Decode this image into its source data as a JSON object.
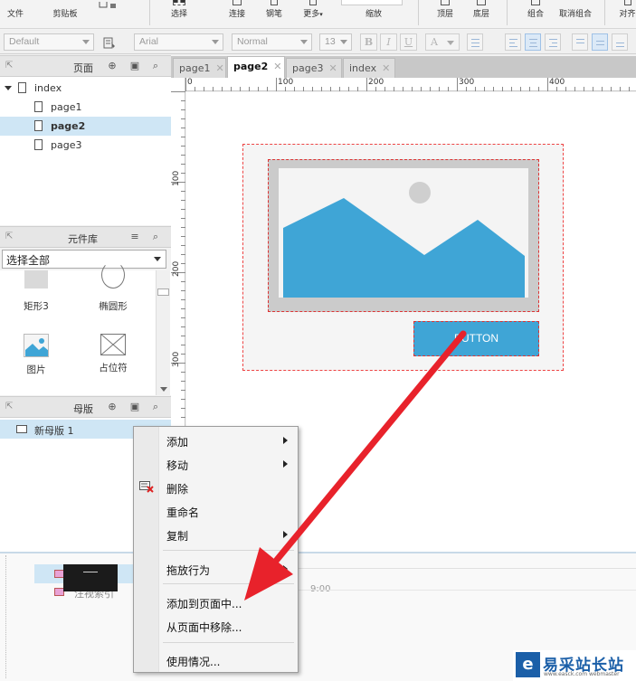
{
  "toolbar": {
    "items": [
      {
        "label": "文件"
      },
      {
        "label": "剪贴板"
      },
      {
        "label": "选择"
      },
      {
        "label": "连接"
      },
      {
        "label": "钢笔"
      },
      {
        "label": "更多"
      },
      {
        "label": "缩放"
      },
      {
        "label": "顶层"
      },
      {
        "label": "底层"
      },
      {
        "label": "组合"
      },
      {
        "label": "取消组合"
      },
      {
        "label": "对齐"
      }
    ],
    "more_chevron": "▾"
  },
  "format_bar": {
    "style_value": "Default",
    "font_value": "Arial",
    "weight_value": "Normal",
    "size_value": "13",
    "bold": "B",
    "italic": "I",
    "underline": "U",
    "font_color": "A"
  },
  "pages_panel": {
    "title": "页面",
    "root": "index",
    "children": [
      "page1",
      "page2",
      "page3"
    ],
    "selected": "page2"
  },
  "library_panel": {
    "title": "元件库",
    "select_value": "选择全部",
    "widgets": [
      {
        "label": "矩形3",
        "icon": "rectangle-icon"
      },
      {
        "label": "椭圆形",
        "icon": "ellipse-icon"
      },
      {
        "label": "图片",
        "icon": "image-icon"
      },
      {
        "label": "占位符",
        "icon": "placeholder-icon"
      }
    ]
  },
  "masters_panel": {
    "title": "母版",
    "items": [
      "新母版 1"
    ]
  },
  "tabs": [
    {
      "label": "page1",
      "active": false
    },
    {
      "label": "page2",
      "active": true
    },
    {
      "label": "page3",
      "active": false
    },
    {
      "label": "index",
      "active": false
    }
  ],
  "ruler": {
    "h_labels": [
      "0",
      "100",
      "200",
      "300",
      "400"
    ],
    "v_labels": [
      "100",
      "200",
      "300"
    ]
  },
  "canvas": {
    "button_label": "BUTTON"
  },
  "context_menu": {
    "items": [
      {
        "label": "添加",
        "submenu": true
      },
      {
        "label": "移动",
        "submenu": true
      },
      {
        "label": "删除",
        "submenu": false
      },
      {
        "label": "重命名",
        "submenu": false
      },
      {
        "label": "复制",
        "submenu": true
      },
      {
        "label": "拖放行为",
        "submenu": true
      },
      {
        "label": "添加到页面中...",
        "submenu": false
      },
      {
        "label": "从页面中移除...",
        "submenu": false
      },
      {
        "label": "使用情况...",
        "submenu": false
      }
    ]
  },
  "bottom": {
    "partial_label": "注视索引",
    "time_text": "9:00"
  },
  "watermark": {
    "logo_char": "e",
    "text": "易采站长站",
    "sub": "www.easck.com webmaster"
  },
  "colors": {
    "accent_blue": "#3fa5d6",
    "selection": "#cfe6f5",
    "annotation_arrow": "#e8222b",
    "dashed_outline": "#e44444"
  }
}
